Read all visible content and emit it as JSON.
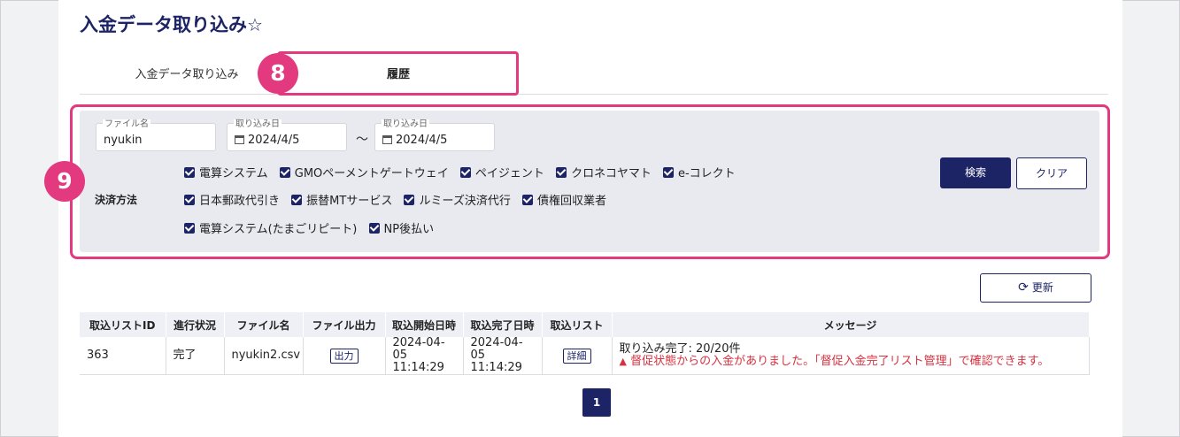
{
  "page": {
    "title": "入金データ取り込み",
    "favorite_icon": "☆"
  },
  "tabs": [
    {
      "label": "入金データ取り込み"
    },
    {
      "label": "履歴",
      "active": true
    }
  ],
  "annotations": {
    "tab_badge": "8",
    "search_badge": "9"
  },
  "search": {
    "file_name_label": "ファイル名",
    "file_name_value": "nyukin",
    "date_from_label": "取り込み日",
    "date_from_value": "2024/4/5",
    "range_separator": "～",
    "date_to_label": "取り込み日",
    "date_to_value": "2024/4/5",
    "method_label": "決済方法",
    "methods": [
      {
        "label": "電算システム",
        "checked": true
      },
      {
        "label": "GMOペーメントゲートウェイ",
        "checked": true
      },
      {
        "label": "ペイジェント",
        "checked": true
      },
      {
        "label": "クロネコヤマト",
        "checked": true
      },
      {
        "label": "e-コレクト",
        "checked": true
      },
      {
        "label": "日本郵政代引き",
        "checked": true
      },
      {
        "label": "振替MTサービス",
        "checked": true
      },
      {
        "label": "ルミーズ決済代行",
        "checked": true
      },
      {
        "label": "債権回収業者",
        "checked": true
      },
      {
        "label": "電算システム(たまごリピート)",
        "checked": true
      },
      {
        "label": "NP後払い",
        "checked": true
      }
    ],
    "search_button": "検索",
    "clear_button": "クリア"
  },
  "refresh_button": "更新",
  "table": {
    "headers": [
      "取込リストID",
      "進行状況",
      "ファイル名",
      "ファイル出力",
      "取込開始日時",
      "取込完了日時",
      "取込リスト",
      "メッセージ"
    ],
    "rows": [
      {
        "id": "363",
        "status": "完了",
        "file_name": "nyukin2.csv",
        "output_button": "出力",
        "start_date": "2024-04-05",
        "start_time": "11:14:29",
        "end_date": "2024-04-05",
        "end_time": "11:14:29",
        "detail_button": "詳細",
        "message": "取り込み完了: 20/20件",
        "warning": "督促状態からの入金がありました。「督促入金完了リスト管理」で確認できます。"
      }
    ]
  },
  "pagination": {
    "current": "1"
  },
  "colors": {
    "primary": "#1c2466",
    "highlight": "#e2397f",
    "warning": "#d6313f"
  }
}
